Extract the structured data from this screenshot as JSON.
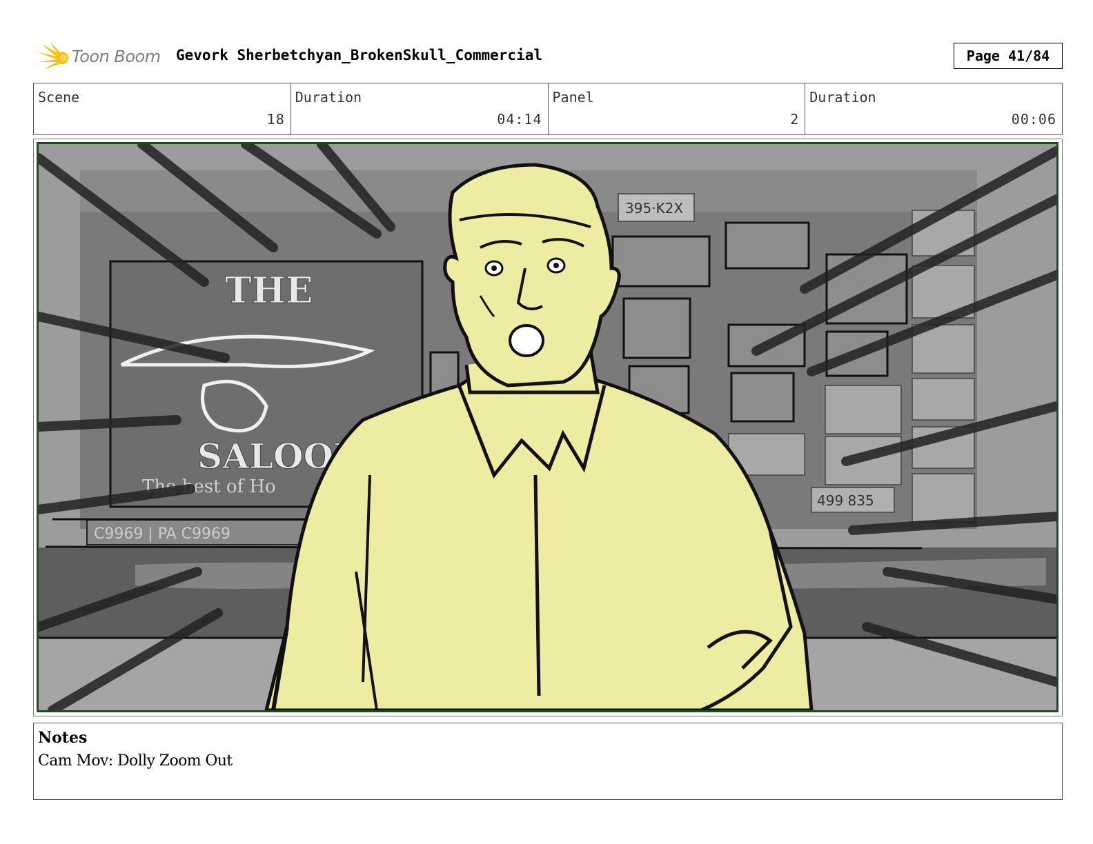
{
  "header": {
    "logo_text": "Toon Boom",
    "project_title": "Gevork Sherbetchyan_BrokenSkull_Commercial",
    "page_label": "Page 41/84"
  },
  "info": {
    "scene_label": "Scene",
    "scene_value": "18",
    "scene_duration_label": "Duration",
    "scene_duration_value": "04:14",
    "panel_label": "Panel",
    "panel_value": "2",
    "panel_duration_label": "Duration",
    "panel_duration_value": "00:06"
  },
  "panel": {
    "description": "storyboard-sketch"
  },
  "notes": {
    "title": "Notes",
    "text": "Cam Mov: Dolly Zoom Out"
  },
  "colors": {
    "logo_flame": "#f2c21b",
    "logo_text": "#7d7d7d",
    "character_fill": "#eeeca2",
    "frame_border": "#1d4d1d"
  }
}
